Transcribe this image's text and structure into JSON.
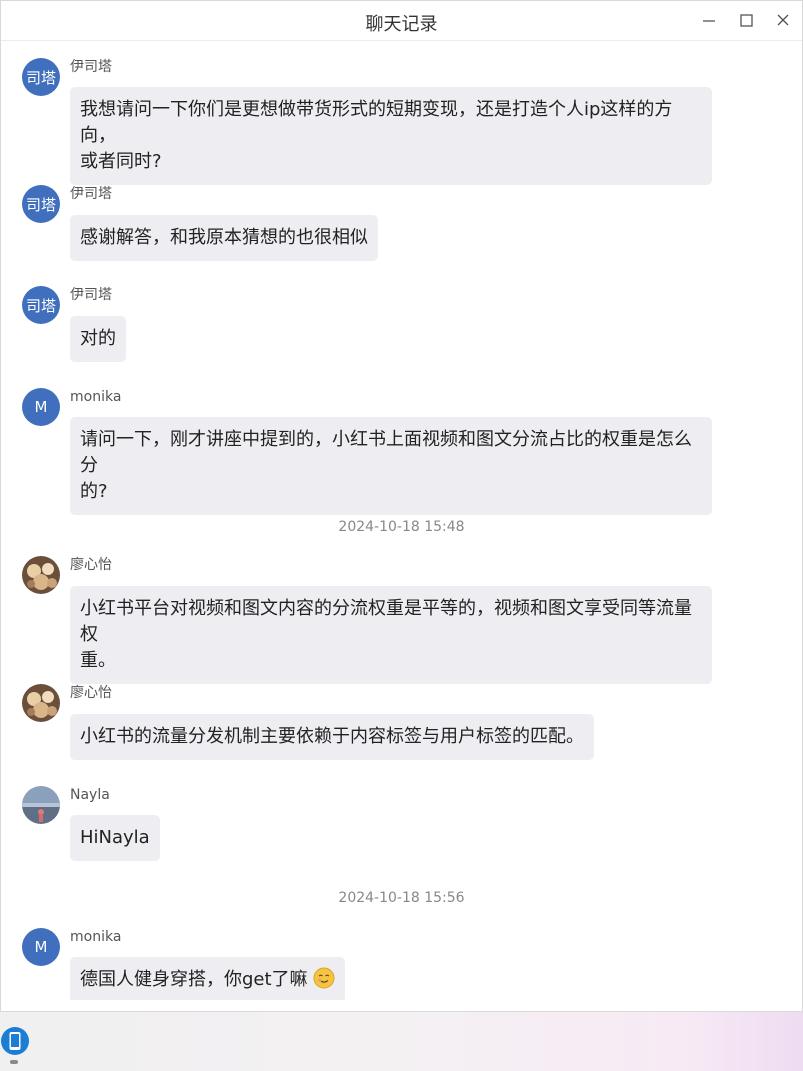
{
  "window": {
    "title": "聊天记录",
    "controls": [
      "minimize-icon",
      "maximize-icon",
      "close-icon"
    ]
  },
  "messages": [
    {
      "sender": "伊司塔",
      "avatar_text": "司塔",
      "avatar_color": "#3f6fbd",
      "text_lines": [
        "我想请问一下你们是更想做带货形式的短期变现，还是打造个人ip这样的方向，",
        "或者同时?"
      ]
    },
    {
      "sender": "伊司塔",
      "avatar_text": "司塔",
      "avatar_color": "#3f6fbd",
      "text_lines": [
        "感谢解答，和我原本猜想的也很相似"
      ]
    },
    {
      "sender": "伊司塔",
      "avatar_text": "司塔",
      "avatar_color": "#3f6fbd",
      "text_lines": [
        "对的"
      ]
    },
    {
      "sender": "monika",
      "avatar_text": "M",
      "avatar_color": "#3f6fbd",
      "text_lines": [
        "请问一下，刚才讲座中提到的，小红书上面视频和图文分流占比的权重是怎么分",
        "的?"
      ]
    },
    {
      "sender": "廖心怡",
      "avatar_icon": "photo-avatar-icon",
      "text_lines": [
        "小红书平台对视频和图文内容的分流权重是平等的，视频和图文享受同等流量权",
        "重。"
      ]
    },
    {
      "sender": "廖心怡",
      "avatar_icon": "photo-avatar-icon",
      "text_lines": [
        "小红书的流量分发机制主要依赖于内容标签与用户标签的匹配。"
      ]
    },
    {
      "sender": "Nayla",
      "avatar_icon": "landscape-avatar-icon",
      "text_lines": [
        "HiNayla"
      ]
    },
    {
      "sender": "monika",
      "avatar_text": "M",
      "avatar_color": "#3f6fbd",
      "text_lines": [
        "德国人健身穿搭，你get了嘛"
      ],
      "trailing_emoji": "smirk-emoji-icon"
    }
  ],
  "timestamps": [
    "2024-10-18 15:48",
    "2024-10-18 15:56"
  ],
  "taskbar": {
    "icon": "phone-icon",
    "accent": "#1a7fd4"
  }
}
